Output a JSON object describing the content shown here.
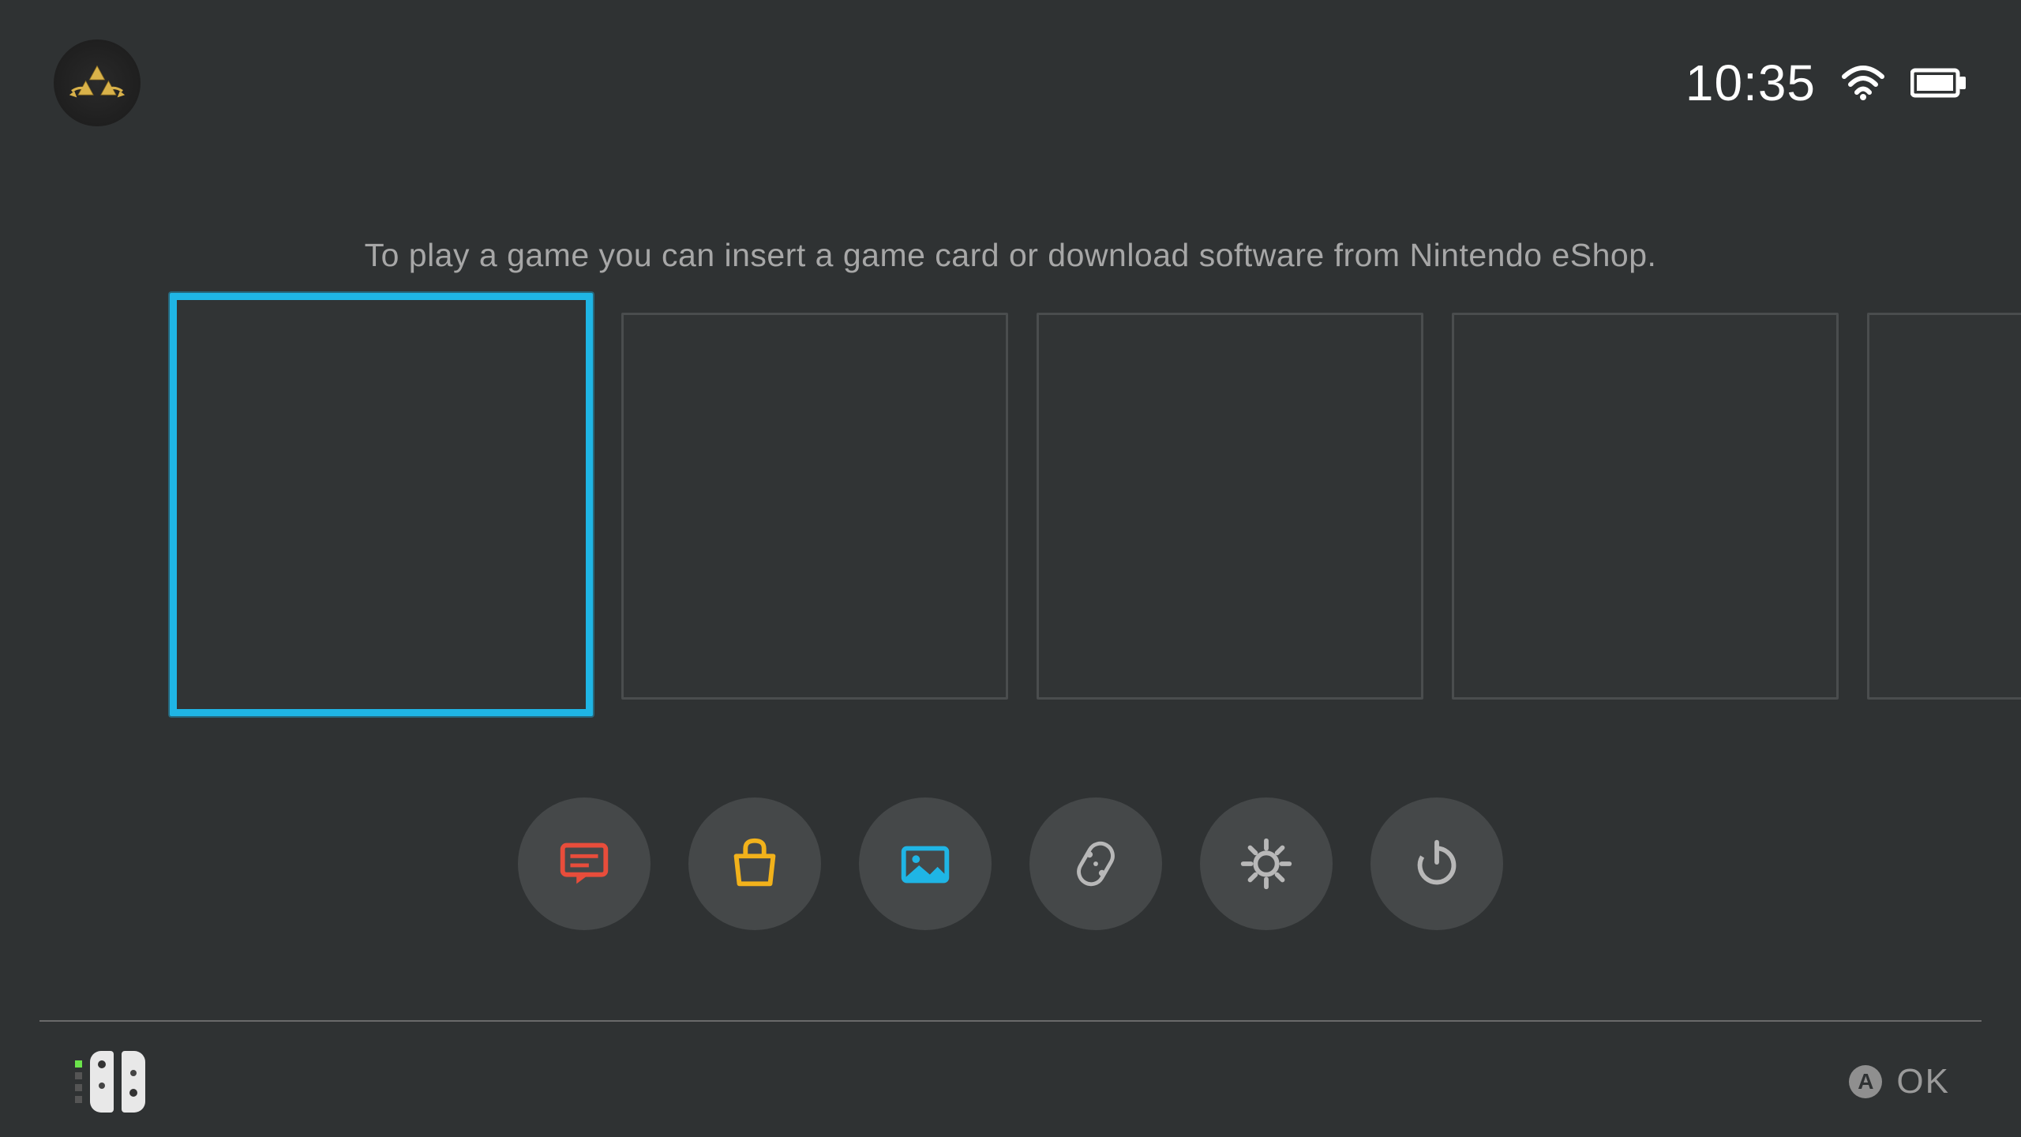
{
  "header": {
    "user_icon": "triforce-avatar",
    "clock": "10:35",
    "wifi_strength": 3,
    "battery_level": "full"
  },
  "hint_text": "To play a game you can insert a game card or download software from Nintendo eShop.",
  "tiles": {
    "selected_index": 0,
    "count_visible": 5
  },
  "menu": {
    "items": [
      {
        "id": "news",
        "icon": "news-icon",
        "color": "#e84d3b"
      },
      {
        "id": "eshop",
        "icon": "eshop-icon",
        "color": "#f2b21b"
      },
      {
        "id": "album",
        "icon": "album-icon",
        "color": "#1fb5e5"
      },
      {
        "id": "controllers",
        "icon": "controllers-icon",
        "color": "#b8b8b8"
      },
      {
        "id": "settings",
        "icon": "settings-icon",
        "color": "#b8b8b8"
      },
      {
        "id": "power",
        "icon": "power-icon",
        "color": "#b8b8b8"
      }
    ]
  },
  "footer": {
    "player_number": 1,
    "controller_type": "joycon-pair",
    "prompt_button": "A",
    "prompt_label": "OK"
  },
  "colors": {
    "bg": "#2f3233",
    "highlight": "#1fb5e5",
    "text_muted": "#a7a7a7"
  }
}
